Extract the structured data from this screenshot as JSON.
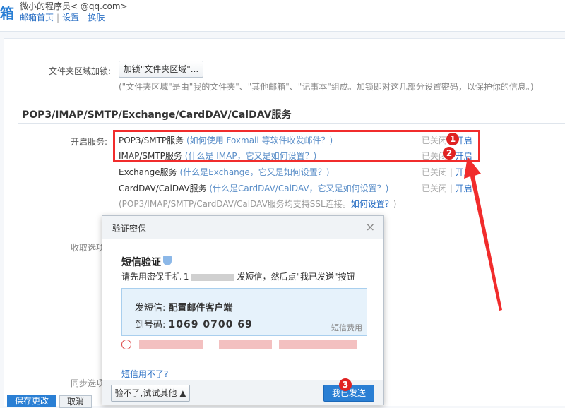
{
  "header": {
    "logo_fragment": "箱",
    "account": "微小的程序员<               @qq.com>",
    "links": [
      "邮箱首页",
      "设置",
      "换肤"
    ]
  },
  "folder_lock": {
    "label": "文件夹区域加锁:",
    "button": "加锁\"文件夹区域\"...",
    "description": "(\"文件夹区域\"是由\"我的文件夹\"、\"其他邮箱\"、\"记事本\"组成。加锁即对这几部分设置密码，以保护你的信息。)"
  },
  "section": {
    "title": "POP3/IMAP/SMTP/Exchange/CardDAV/CalDAV服务",
    "enable_label": "开启服务:",
    "services": [
      {
        "name": "POP3/SMTP服务",
        "help": "(如何使用 Foxmail 等软件收发邮件？)",
        "off": "已关闭",
        "on": "开启"
      },
      {
        "name": "IMAP/SMTP服务",
        "help": "(什么是 IMAP，它又是如何设置？)",
        "off": "已关闭",
        "on": "开启"
      },
      {
        "name": "Exchange服务",
        "help": "(什么是Exchange，它又是如何设置？)",
        "off": "已关闭",
        "on": "开启"
      },
      {
        "name": "CardDAV/CalDAV服务",
        "help": "(什么是CardDAV/CalDAV，它又是如何设置？)",
        "off": "已关闭",
        "on": "开启"
      }
    ],
    "ssl_note": "(POP3/IMAP/SMTP/CardDAV/CalDAV服务均支持SSL连接。",
    "ssl_link": "如何设置？",
    "ssl_close": ")",
    "receive_label": "收取选项",
    "sync_label": "同步选项"
  },
  "annotations": [
    "1",
    "2",
    "3"
  ],
  "dialog": {
    "title": "验证密保",
    "close": "×",
    "sms_title": "短信验证",
    "instruction_prefix": "请先用密保手机 1",
    "instruction_suffix": "发短信，然后点\"我已发送\"按钮",
    "send_label": "发短信:",
    "send_content": "配置邮件客户端",
    "to_label": "到号码:",
    "to_number": "1069 0700 69",
    "fee": "短信费用",
    "sms_unavailable": "短信用不了?",
    "other_button": "验不了,试试其他",
    "sent_button": "我已发送"
  },
  "bottom": {
    "save": "保存更改",
    "cancel": "取消"
  },
  "colors": {
    "accent": "#2a7fd4",
    "annotation_red": "#f12c2c"
  }
}
